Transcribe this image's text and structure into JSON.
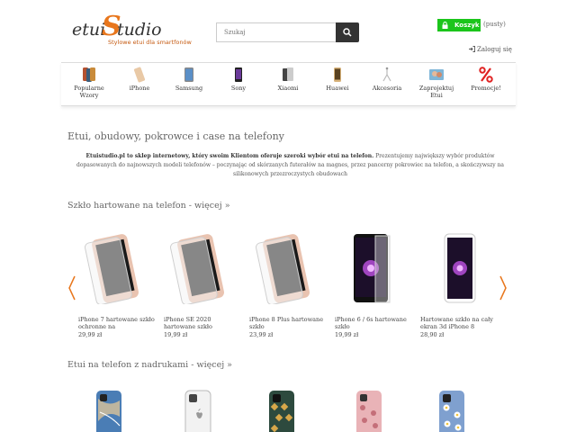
{
  "header": {
    "logo_etui": "etui",
    "logo_s": "S",
    "logo_studio": "tudio",
    "logo_tagline": "Stylowe etui dla smartfonów",
    "search_placeholder": "Szukaj",
    "cart_label": "Koszyk",
    "cart_status": "(pusty)",
    "login_label": "Zaloguj się"
  },
  "nav": {
    "items": [
      {
        "label": "Popularne Wzory"
      },
      {
        "label": "iPhone"
      },
      {
        "label": "Samsung"
      },
      {
        "label": "Sony"
      },
      {
        "label": "Xiaomi"
      },
      {
        "label": "Huawei"
      },
      {
        "label": "Akcesoria"
      },
      {
        "label": "Zaprojektuj Etui"
      },
      {
        "label": "Promocje!"
      }
    ]
  },
  "main": {
    "title": "Etui, obudowy, pokrowce i case na telefony",
    "intro_bold": "Etuistudio.pl to sklep internetowy, który swoim Klientom oferuje szeroki wybór etui na telefon.",
    "intro_rest": " Prezentujemy największy wybór produktów dopasowanych do najnowszych modeli telefonów – poczynając od skórzanych futerałów na magnes, przez pancerny pokrowiec na telefon, a skończywszy na silikonowych przezroczystych obudowach",
    "section_glass": "Szkło hartowane na telefon - więcej »",
    "section_cases": "Etui na telefon z nadrukami - więcej »",
    "glass_products": [
      {
        "name": "iPhone 7 hartowane szkło ochronne na",
        "price": "29,99 zł"
      },
      {
        "name": "iPhone SE 2020 hartowane szkło",
        "price": "19,99 zł"
      },
      {
        "name": "iPhone 8 Plus hartowane szkło",
        "price": "23,99 zł"
      },
      {
        "name": "iPhone 6 / 6s hartowane szkło",
        "price": "19,99 zł"
      },
      {
        "name": "Hartowane szkło na cały ekran 3d iPhone 8",
        "price": "28,90 zł"
      }
    ]
  },
  "colors": {
    "accent_orange": "#e8761c",
    "cart_green": "#1bc51b",
    "promo_red": "#e02020"
  }
}
